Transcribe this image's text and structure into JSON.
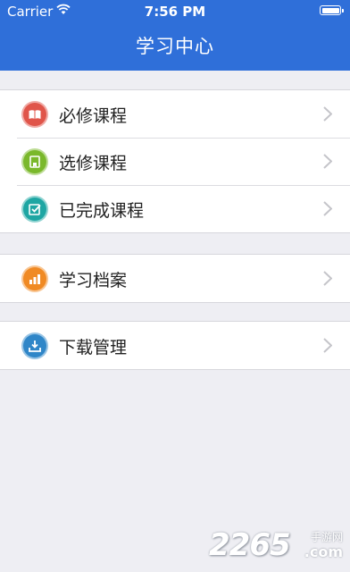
{
  "status_bar": {
    "carrier": "Carrier",
    "time": "7:56 PM"
  },
  "header": {
    "title": "学习中心"
  },
  "groups": [
    {
      "items": [
        {
          "label": "必修课程",
          "icon": "book-icon",
          "color": "#e0554a"
        },
        {
          "label": "选修课程",
          "icon": "bookmark-icon",
          "color": "#7ab82b"
        },
        {
          "label": "已完成课程",
          "icon": "checkbox-icon",
          "color": "#1ea6a3"
        }
      ]
    },
    {
      "items": [
        {
          "label": "学习档案",
          "icon": "bar-chart-icon",
          "color": "#f08a24"
        }
      ]
    },
    {
      "items": [
        {
          "label": "下载管理",
          "icon": "download-icon",
          "color": "#2f86c8"
        }
      ]
    }
  ],
  "watermark": {
    "number": "2265",
    "brand": "手游网",
    "suffix": ".com"
  },
  "colors": {
    "nav_bar": "#2f6fd9",
    "background": "#eeeef3"
  }
}
